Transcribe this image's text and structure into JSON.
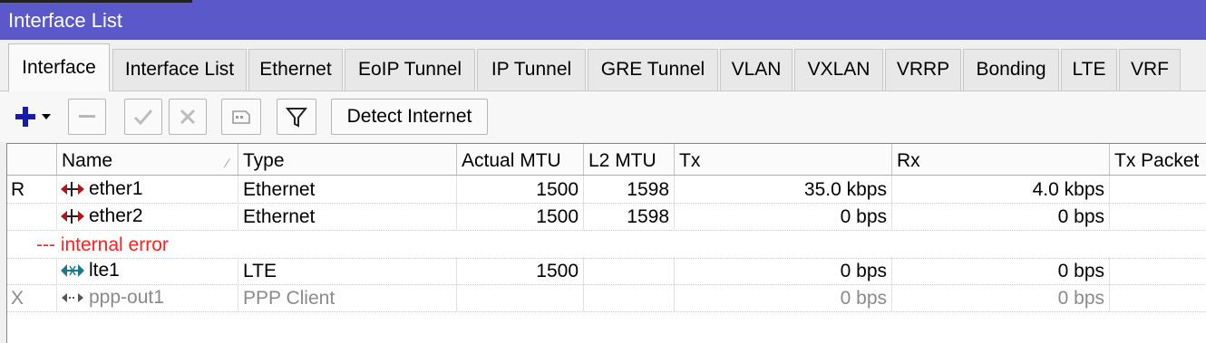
{
  "window": {
    "title": "Interface List"
  },
  "tabs": [
    {
      "label": "Interface",
      "active": true
    },
    {
      "label": "Interface List"
    },
    {
      "label": "Ethernet"
    },
    {
      "label": "EoIP Tunnel"
    },
    {
      "label": "IP Tunnel"
    },
    {
      "label": "GRE Tunnel"
    },
    {
      "label": "VLAN"
    },
    {
      "label": "VXLAN"
    },
    {
      "label": "VRRP"
    },
    {
      "label": "Bonding"
    },
    {
      "label": "LTE"
    },
    {
      "label": "VRF"
    }
  ],
  "toolbar": {
    "add_icon": "plus-icon",
    "remove_icon": "minus-icon",
    "enable_icon": "check-icon",
    "disable_icon": "x-icon",
    "comment_icon": "note-icon",
    "filter_icon": "funnel-icon",
    "detect_label": "Detect Internet"
  },
  "table": {
    "columns": [
      "",
      "Name",
      "Type",
      "Actual MTU",
      "L2 MTU",
      "Tx",
      "Rx",
      "Tx Packet"
    ],
    "sorted_column": "Name",
    "rows": [
      {
        "flag": "R",
        "name": "ether1",
        "icon": "ethernet-icon",
        "type": "Ethernet",
        "actual_mtu": "1500",
        "l2_mtu": "1598",
        "tx": "35.0 kbps",
        "rx": "4.0 kbps",
        "tx_packet": ""
      },
      {
        "flag": "",
        "name": "ether2",
        "icon": "ethernet-icon",
        "type": "Ethernet",
        "actual_mtu": "1500",
        "l2_mtu": "1598",
        "tx": "0 bps",
        "rx": "0 bps",
        "tx_packet": ""
      },
      {
        "flag": "",
        "name": "lte1",
        "icon": "lte-icon",
        "type": "LTE",
        "actual_mtu": "1500",
        "l2_mtu": "",
        "tx": "0 bps",
        "rx": "0 bps",
        "tx_packet": ""
      },
      {
        "flag": "X",
        "name": "ppp-out1",
        "icon": "ppp-icon",
        "type": "PPP Client",
        "actual_mtu": "",
        "l2_mtu": "",
        "tx": "0 bps",
        "rx": "0 bps",
        "tx_packet": ""
      }
    ],
    "separator": "--- internal error"
  },
  "colors": {
    "titlebar": "#5b59c9",
    "error_text": "#ff2020",
    "disabled_text": "#8a8a8a"
  }
}
